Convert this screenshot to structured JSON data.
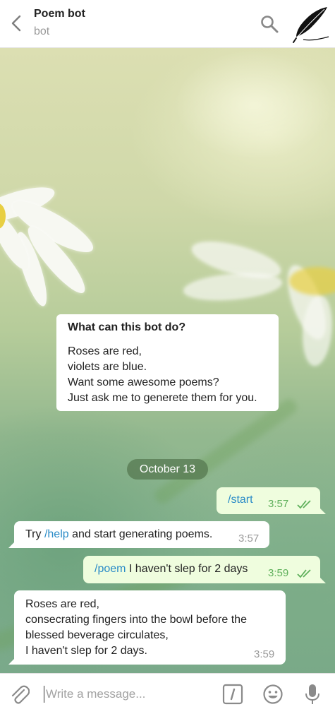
{
  "header": {
    "title": "Poem bot",
    "subtitle": "bot"
  },
  "info_card": {
    "title": "What can this bot do?",
    "lines": [
      "Roses are red,",
      "violets are blue.",
      "Want some awesome poems?",
      "Just ask me to generete them for you."
    ]
  },
  "date_chip": "October 13",
  "messages": [
    {
      "direction": "out",
      "command": "/start",
      "text": "",
      "time": "3:57",
      "status": "read"
    },
    {
      "direction": "in",
      "prefix": "Try ",
      "command": "/help",
      "text": " and start generating poems.",
      "time": "3:57"
    },
    {
      "direction": "out",
      "command": "/poem",
      "text": " I haven't slep for 2 days",
      "time": "3:59",
      "status": "read"
    },
    {
      "direction": "in",
      "lines": [
        "Roses are red,",
        "consecrating fingers into the bowl before the",
        "blessed beverage circulates,",
        "I haven't slep for 2 days."
      ],
      "time": "3:59"
    }
  ],
  "composer": {
    "placeholder": "Write a message..."
  },
  "colors": {
    "outgoing_bubble": "#effdde",
    "incoming_bubble": "#ffffff",
    "command_link": "#2a8bc7",
    "read_check": "#5fb05b",
    "date_chip": "#5f7f55"
  },
  "icons": [
    "back-arrow-icon",
    "search-icon",
    "feather-avatar-icon",
    "paperclip-icon",
    "slash-command-icon",
    "emoji-icon",
    "microphone-icon",
    "double-check-icon"
  ]
}
